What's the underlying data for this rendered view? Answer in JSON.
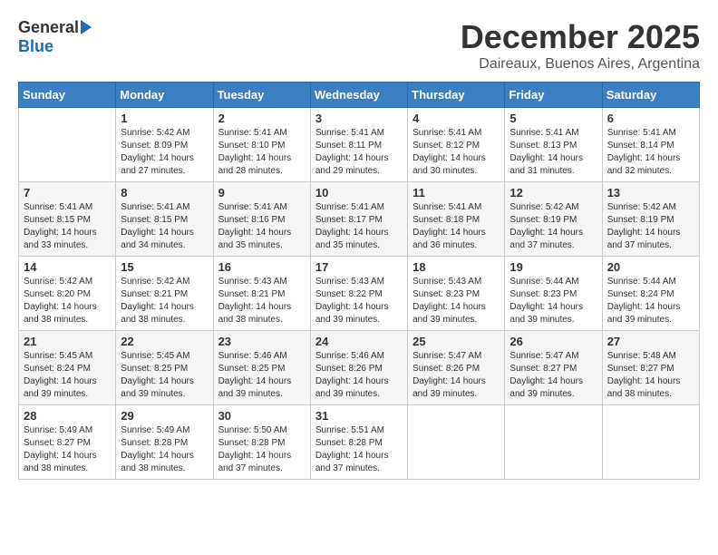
{
  "logo": {
    "general": "General",
    "blue": "Blue"
  },
  "title": "December 2025",
  "subtitle": "Daireaux, Buenos Aires, Argentina",
  "weekdays": [
    "Sunday",
    "Monday",
    "Tuesday",
    "Wednesday",
    "Thursday",
    "Friday",
    "Saturday"
  ],
  "weeks": [
    [
      {
        "day": "",
        "info": ""
      },
      {
        "day": "1",
        "info": "Sunrise: 5:42 AM\nSunset: 8:09 PM\nDaylight: 14 hours\nand 27 minutes."
      },
      {
        "day": "2",
        "info": "Sunrise: 5:41 AM\nSunset: 8:10 PM\nDaylight: 14 hours\nand 28 minutes."
      },
      {
        "day": "3",
        "info": "Sunrise: 5:41 AM\nSunset: 8:11 PM\nDaylight: 14 hours\nand 29 minutes."
      },
      {
        "day": "4",
        "info": "Sunrise: 5:41 AM\nSunset: 8:12 PM\nDaylight: 14 hours\nand 30 minutes."
      },
      {
        "day": "5",
        "info": "Sunrise: 5:41 AM\nSunset: 8:13 PM\nDaylight: 14 hours\nand 31 minutes."
      },
      {
        "day": "6",
        "info": "Sunrise: 5:41 AM\nSunset: 8:14 PM\nDaylight: 14 hours\nand 32 minutes."
      }
    ],
    [
      {
        "day": "7",
        "info": "Sunrise: 5:41 AM\nSunset: 8:15 PM\nDaylight: 14 hours\nand 33 minutes."
      },
      {
        "day": "8",
        "info": "Sunrise: 5:41 AM\nSunset: 8:15 PM\nDaylight: 14 hours\nand 34 minutes."
      },
      {
        "day": "9",
        "info": "Sunrise: 5:41 AM\nSunset: 8:16 PM\nDaylight: 14 hours\nand 35 minutes."
      },
      {
        "day": "10",
        "info": "Sunrise: 5:41 AM\nSunset: 8:17 PM\nDaylight: 14 hours\nand 35 minutes."
      },
      {
        "day": "11",
        "info": "Sunrise: 5:41 AM\nSunset: 8:18 PM\nDaylight: 14 hours\nand 36 minutes."
      },
      {
        "day": "12",
        "info": "Sunrise: 5:42 AM\nSunset: 8:19 PM\nDaylight: 14 hours\nand 37 minutes."
      },
      {
        "day": "13",
        "info": "Sunrise: 5:42 AM\nSunset: 8:19 PM\nDaylight: 14 hours\nand 37 minutes."
      }
    ],
    [
      {
        "day": "14",
        "info": "Sunrise: 5:42 AM\nSunset: 8:20 PM\nDaylight: 14 hours\nand 38 minutes."
      },
      {
        "day": "15",
        "info": "Sunrise: 5:42 AM\nSunset: 8:21 PM\nDaylight: 14 hours\nand 38 minutes."
      },
      {
        "day": "16",
        "info": "Sunrise: 5:43 AM\nSunset: 8:21 PM\nDaylight: 14 hours\nand 38 minutes."
      },
      {
        "day": "17",
        "info": "Sunrise: 5:43 AM\nSunset: 8:22 PM\nDaylight: 14 hours\nand 39 minutes."
      },
      {
        "day": "18",
        "info": "Sunrise: 5:43 AM\nSunset: 8:23 PM\nDaylight: 14 hours\nand 39 minutes."
      },
      {
        "day": "19",
        "info": "Sunrise: 5:44 AM\nSunset: 8:23 PM\nDaylight: 14 hours\nand 39 minutes."
      },
      {
        "day": "20",
        "info": "Sunrise: 5:44 AM\nSunset: 8:24 PM\nDaylight: 14 hours\nand 39 minutes."
      }
    ],
    [
      {
        "day": "21",
        "info": "Sunrise: 5:45 AM\nSunset: 8:24 PM\nDaylight: 14 hours\nand 39 minutes."
      },
      {
        "day": "22",
        "info": "Sunrise: 5:45 AM\nSunset: 8:25 PM\nDaylight: 14 hours\nand 39 minutes."
      },
      {
        "day": "23",
        "info": "Sunrise: 5:46 AM\nSunset: 8:25 PM\nDaylight: 14 hours\nand 39 minutes."
      },
      {
        "day": "24",
        "info": "Sunrise: 5:46 AM\nSunset: 8:26 PM\nDaylight: 14 hours\nand 39 minutes."
      },
      {
        "day": "25",
        "info": "Sunrise: 5:47 AM\nSunset: 8:26 PM\nDaylight: 14 hours\nand 39 minutes."
      },
      {
        "day": "26",
        "info": "Sunrise: 5:47 AM\nSunset: 8:27 PM\nDaylight: 14 hours\nand 39 minutes."
      },
      {
        "day": "27",
        "info": "Sunrise: 5:48 AM\nSunset: 8:27 PM\nDaylight: 14 hours\nand 38 minutes."
      }
    ],
    [
      {
        "day": "28",
        "info": "Sunrise: 5:49 AM\nSunset: 8:27 PM\nDaylight: 14 hours\nand 38 minutes."
      },
      {
        "day": "29",
        "info": "Sunrise: 5:49 AM\nSunset: 8:28 PM\nDaylight: 14 hours\nand 38 minutes."
      },
      {
        "day": "30",
        "info": "Sunrise: 5:50 AM\nSunset: 8:28 PM\nDaylight: 14 hours\nand 37 minutes."
      },
      {
        "day": "31",
        "info": "Sunrise: 5:51 AM\nSunset: 8:28 PM\nDaylight: 14 hours\nand 37 minutes."
      },
      {
        "day": "",
        "info": ""
      },
      {
        "day": "",
        "info": ""
      },
      {
        "day": "",
        "info": ""
      }
    ]
  ]
}
